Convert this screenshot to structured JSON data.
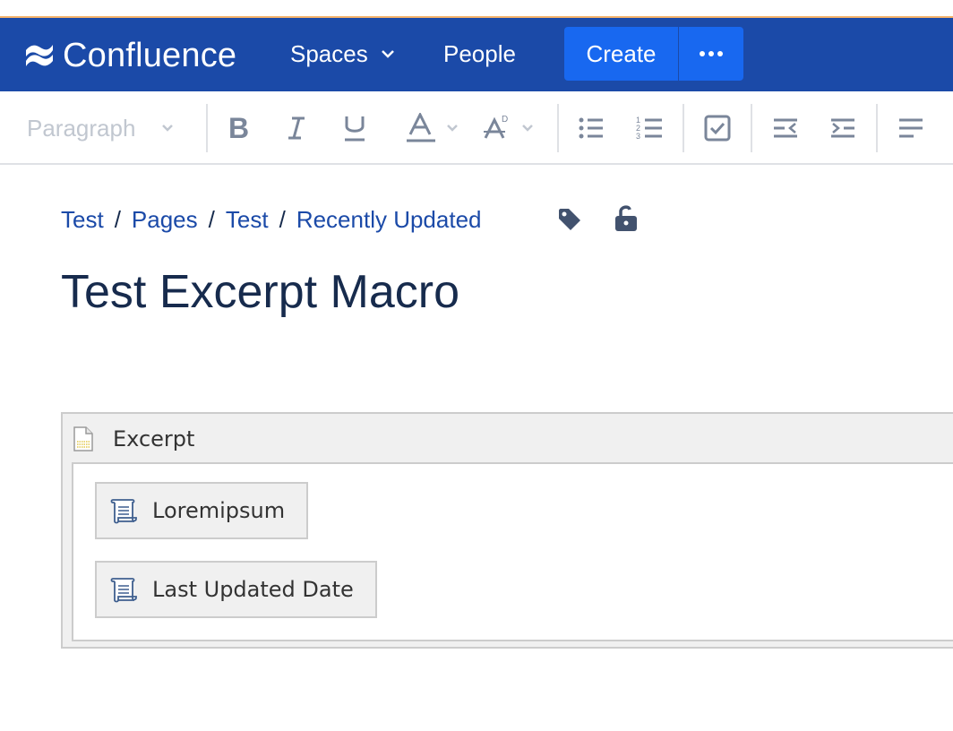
{
  "navbar": {
    "app_name": "Confluence",
    "spaces_label": "Spaces",
    "people_label": "People",
    "create_label": "Create",
    "brand_color": "#1b4aa8",
    "button_color": "#1868f0"
  },
  "toolbar": {
    "paragraph_label": "Paragraph",
    "buttons": [
      "bold-icon",
      "italic-icon",
      "underline-icon",
      "text-color-icon",
      "clear-format-icon",
      "bullet-list-icon",
      "numbered-list-icon",
      "task-list-icon",
      "outdent-icon",
      "indent-icon",
      "align-left-icon"
    ]
  },
  "breadcrumb": {
    "items": [
      "Test",
      "Pages",
      "Test",
      "Recently Updated"
    ],
    "separator": "/"
  },
  "page": {
    "title": "Test Excerpt Macro"
  },
  "excerpt_macro": {
    "label": "Excerpt",
    "inner_macros": [
      "Loremipsum",
      "Last Updated Date"
    ]
  }
}
